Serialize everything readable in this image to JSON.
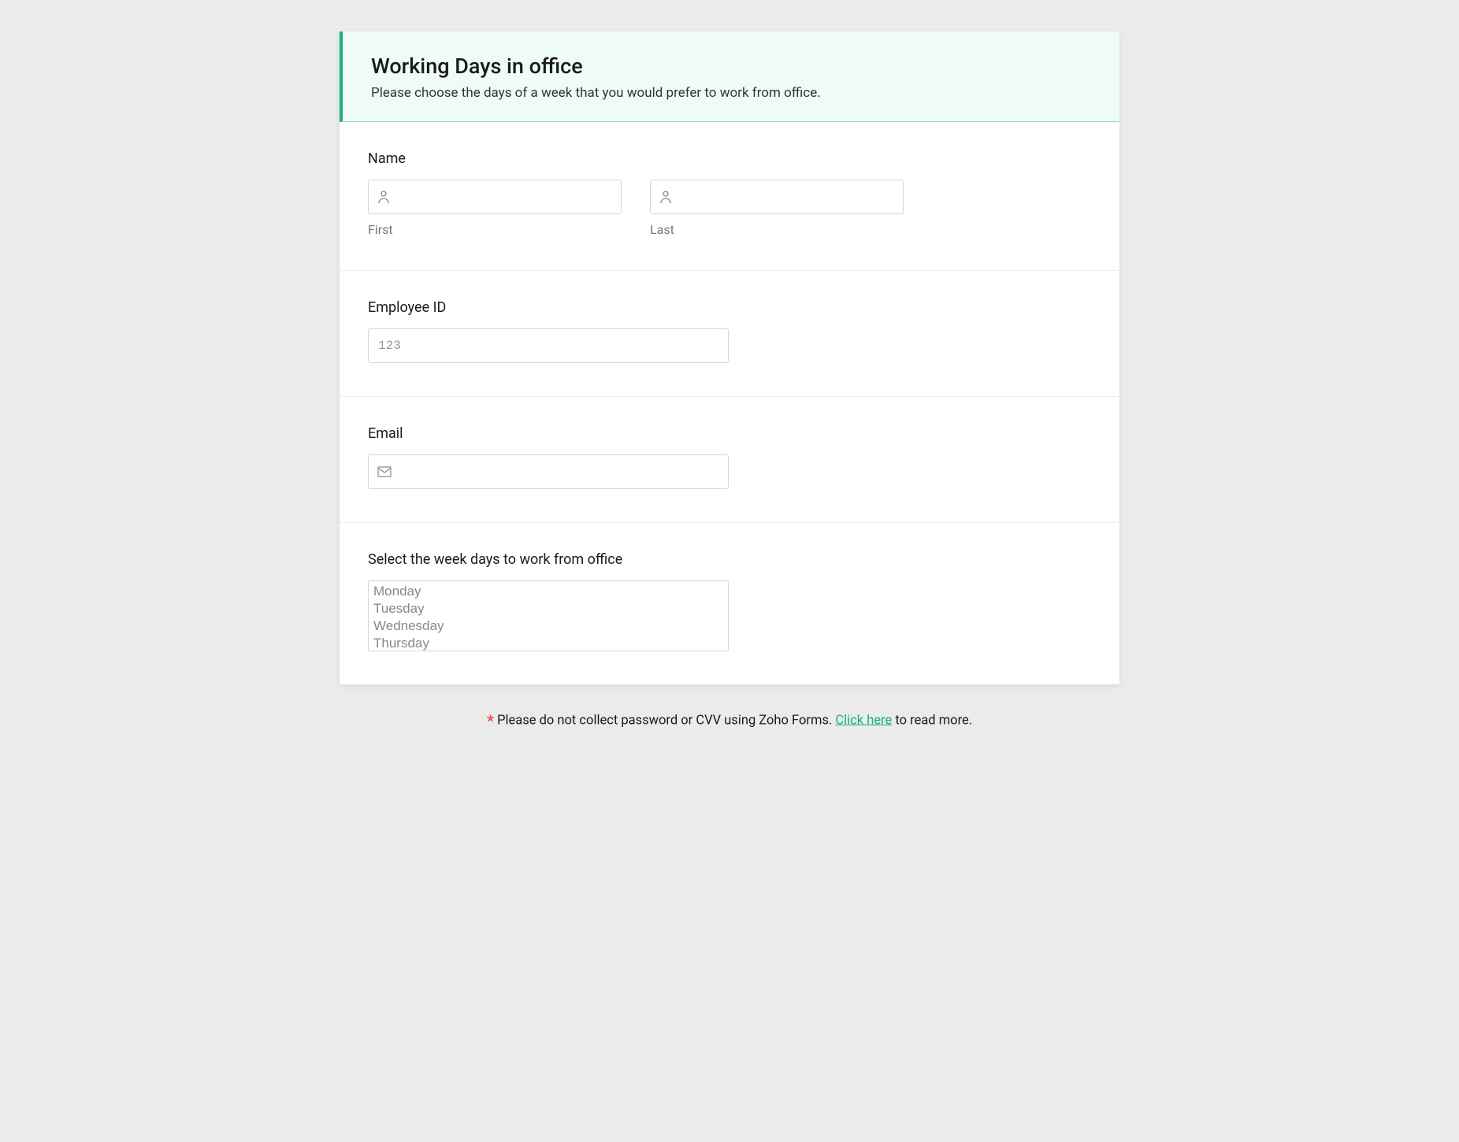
{
  "header": {
    "title": "Working Days in office",
    "subtitle": "Please choose the days of a week that you would prefer to work from office."
  },
  "fields": {
    "name": {
      "label": "Name",
      "first_sublabel": "First",
      "last_sublabel": "Last"
    },
    "employee_id": {
      "label": "Employee ID",
      "placeholder": "123"
    },
    "email": {
      "label": "Email"
    },
    "weekdays": {
      "label": "Select the week days to work from office",
      "options": [
        "Monday",
        "Tuesday",
        "Wednesday",
        "Thursday"
      ]
    }
  },
  "footer": {
    "asterisk": "*",
    "text_before": " Please do not collect password or CVV using Zoho Forms. ",
    "link_text": "Click here",
    "text_after": " to read more."
  }
}
